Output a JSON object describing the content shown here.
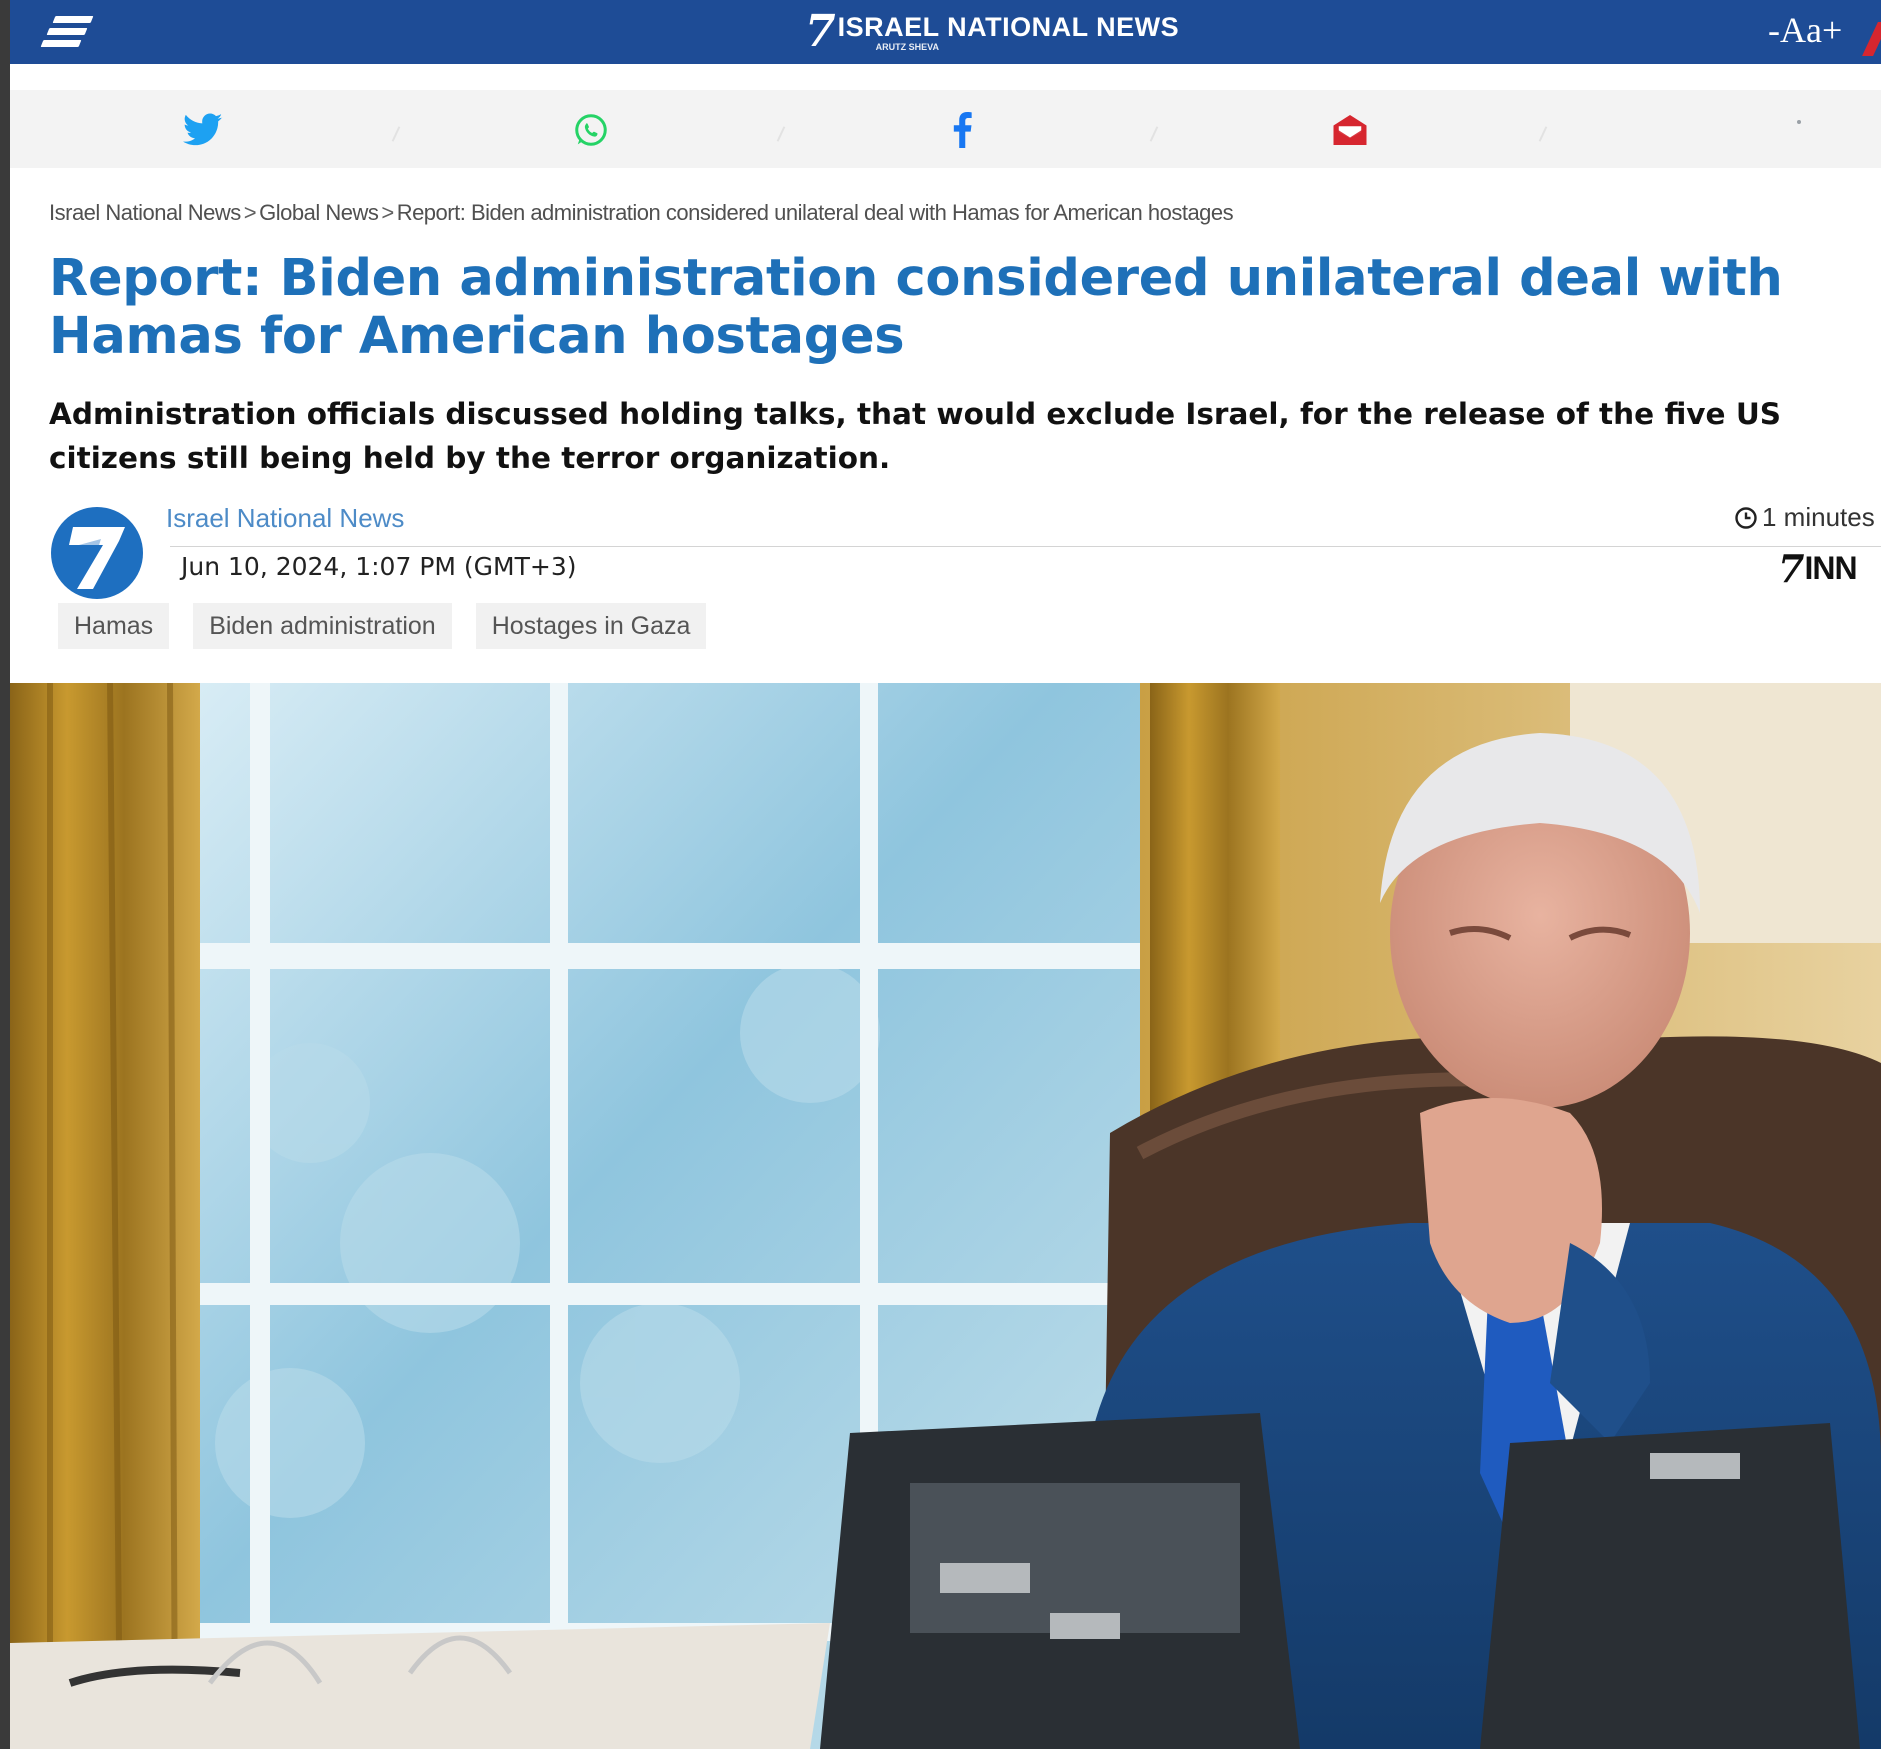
{
  "header": {
    "logo_title": "ISRAEL NATIONAL NEWS",
    "logo_subtitle": "ARUTZ SHEVA",
    "font_size_control": "-Aa+",
    "brand_color": "#1e4c96"
  },
  "share": {
    "icons": [
      "twitter-icon",
      "whatsapp-icon",
      "facebook-icon",
      "email-icon"
    ],
    "colors": {
      "twitter": "#1da1f2",
      "whatsapp": "#25d366",
      "facebook": "#1877f2",
      "email": "#d6262f"
    }
  },
  "breadcrumb": {
    "items": [
      "Israel National News",
      "Global News",
      "Report: Biden administration considered unilateral deal with Hamas for American hostages"
    ],
    "separator": ">"
  },
  "article": {
    "headline": "Report: Biden administration considered unilateral deal with Hamas for American hostages",
    "subheadline": "Administration officials discussed holding talks, that would exclude Israel, for the release of the five US citizens still being held by the terror organization.",
    "author": "Israel National News",
    "date": "Jun 10, 2024, 1:07 PM (GMT+3)",
    "read_time": "1 minutes",
    "source_logo": "INN",
    "tags": [
      "Hamas",
      "Biden administration",
      "Hostages in Gaza"
    ],
    "headline_color": "#1e70b8"
  }
}
